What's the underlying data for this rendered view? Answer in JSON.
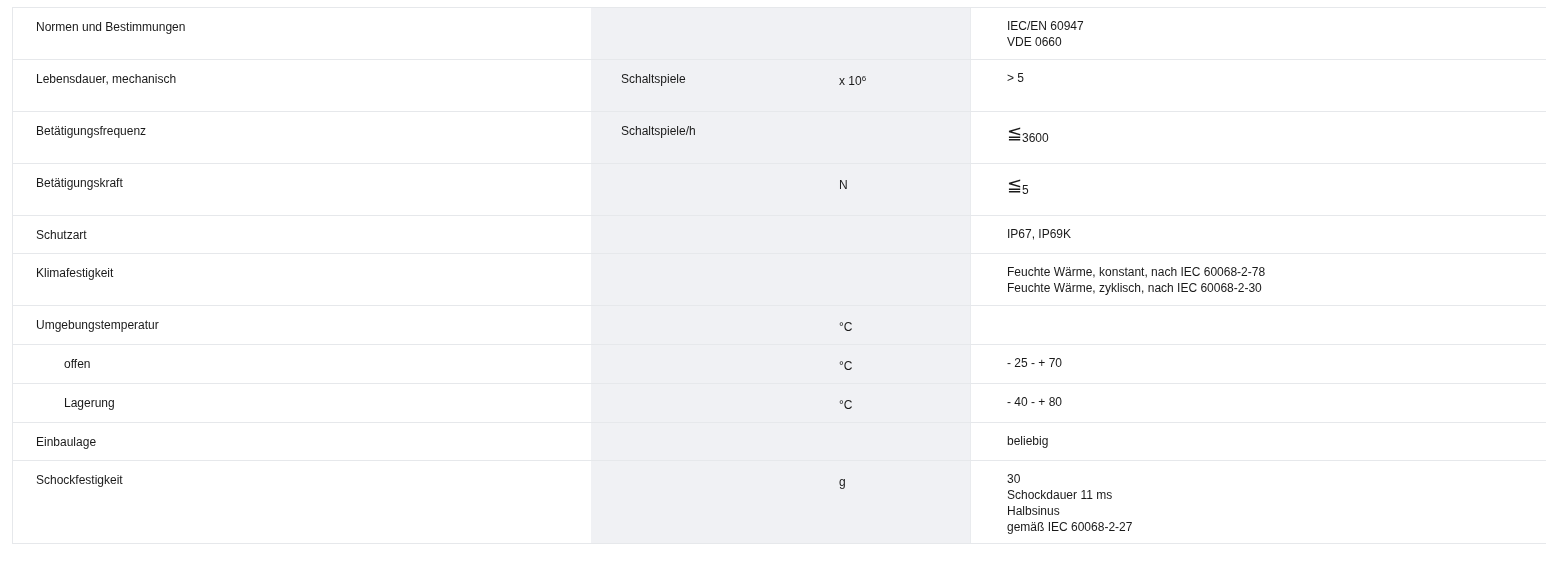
{
  "spec_table": {
    "rows": [
      {
        "name": "Normen und Bestimmungen",
        "value": [
          "IEC/EN 60947",
          "VDE 0660"
        ]
      },
      {
        "name": "Lebensdauer, mechanisch",
        "condition": "Schaltspiele",
        "unit": "x 10$^{6}$",
        "value": [
          "> 5"
        ]
      },
      {
        "name": "Betätigungsfrequenz",
        "condition": "Schaltspiele/h",
        "value": [
          "≦$_{3600}$"
        ]
      },
      {
        "name": "Betätigungskraft",
        "unit": "N",
        "value": [
          "≦$_{5}$"
        ]
      },
      {
        "name": "Schutzart",
        "value": [
          "IP67, IP69K"
        ]
      },
      {
        "name": "Klimafestigkeit",
        "value": [
          "Feuchte Wärme, konstant, nach IEC 60068-2-78",
          "Feuchte Wärme, zyklisch, nach IEC 60068-2-30"
        ]
      },
      {
        "name": "Umgebungstemperatur",
        "unit": "°C",
        "children": [
          {
            "name": "offen",
            "unit": "°C",
            "value": [
              "- 25 - + 70"
            ]
          },
          {
            "name": "Lagerung",
            "unit": "°C",
            "value": [
              "- 40 - + 80"
            ]
          }
        ]
      },
      {
        "name": "Einbaulage",
        "value": [
          "beliebig"
        ]
      },
      {
        "name": "Schockfestigkeit",
        "unit": "g",
        "value": [
          "30",
          "Schockdauer 11 ms",
          "Halbsinus",
          "gemäß IEC 60068-2-27"
        ]
      }
    ]
  }
}
